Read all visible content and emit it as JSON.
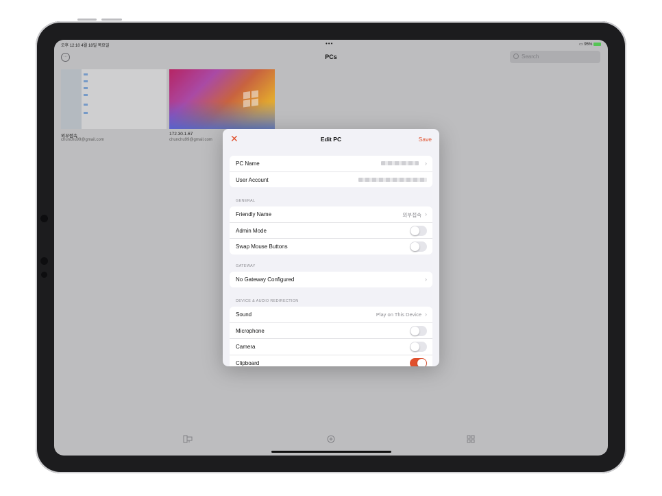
{
  "status": {
    "time": "오후 12:10  4월 18일 목요일",
    "dots": "•••",
    "battery": "95%"
  },
  "header": {
    "title": "PCs",
    "more_icon": "ellipsis-circle-icon",
    "search_placeholder": "Search"
  },
  "pcs": [
    {
      "name": "외부접속",
      "account": "chunchu99@gmail.com"
    },
    {
      "name": "172.30.1.67",
      "account": "chunchu99@gmail.com"
    }
  ],
  "tabbar": {
    "icons": [
      "desktop-icon",
      "add-circle-icon",
      "apps-icon"
    ]
  },
  "modal": {
    "title": "Edit PC",
    "close_icon": "close-icon",
    "save_label": "Save",
    "top_rows": [
      {
        "label": "PC Name"
      },
      {
        "label": "User Account"
      }
    ],
    "general": {
      "header": "GENERAL",
      "rows": [
        {
          "label": "Friendly Name",
          "value": "외부접속"
        },
        {
          "label": "Admin Mode",
          "on": false
        },
        {
          "label": "Swap Mouse Buttons",
          "on": false
        }
      ]
    },
    "gateway": {
      "header": "GATEWAY",
      "rows": [
        {
          "label": "No Gateway Configured"
        }
      ]
    },
    "redirection": {
      "header": "DEVICE & AUDIO REDIRECTION",
      "rows": [
        {
          "label": "Sound",
          "value": "Play on This Device"
        },
        {
          "label": "Microphone",
          "on": false
        },
        {
          "label": "Camera",
          "on": false
        },
        {
          "label": "Clipboard",
          "on": true
        }
      ]
    }
  },
  "colors": {
    "accent": "#e0502d",
    "toggle_off": "#e5e5ea",
    "grouped_bg": "#f2f2f7"
  }
}
